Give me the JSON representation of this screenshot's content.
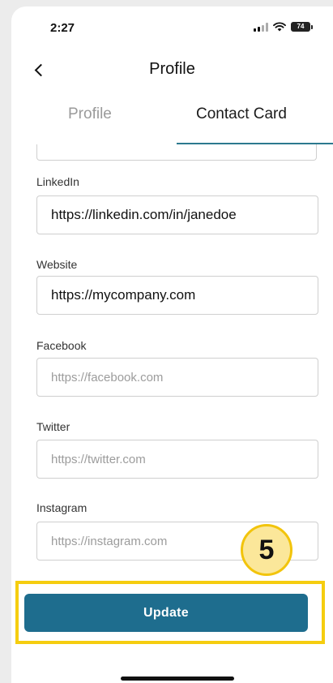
{
  "status_bar": {
    "time": "2:27",
    "battery": "74"
  },
  "header": {
    "title": "Profile",
    "back_icon": "chevron-left-icon"
  },
  "tabs": [
    {
      "label": "Profile",
      "active": false
    },
    {
      "label": "Contact Card",
      "active": true
    }
  ],
  "fields": [
    {
      "label": "LinkedIn",
      "value": "https://linkedin.com/in/janedoe",
      "placeholder": ""
    },
    {
      "label": "Website",
      "value": "https://mycompany.com",
      "placeholder": ""
    },
    {
      "label": "Facebook",
      "value": "",
      "placeholder": "https://facebook.com"
    },
    {
      "label": "Twitter",
      "value": "",
      "placeholder": "https://twitter.com"
    },
    {
      "label": "Instagram",
      "value": "",
      "placeholder": "https://instagram.com"
    }
  ],
  "update_button": {
    "label": "Update"
  },
  "step_badge": {
    "number": "5"
  },
  "colors": {
    "accent": "#1e6d8e",
    "tab_underline": "#2c7a8e",
    "highlight": "#f5cd0f",
    "badge_fill": "#fbe79a"
  }
}
